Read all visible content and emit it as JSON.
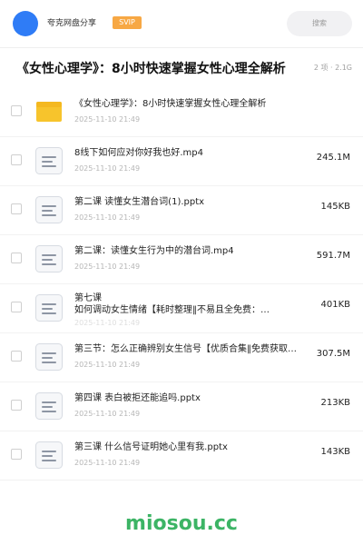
{
  "header": {
    "site_name": "夸克网盘分享",
    "badge": "SVIP",
    "search_placeholder": "搜索"
  },
  "folder": {
    "title": "《女性心理学》：8小时快速掌握女性心理全解析",
    "meta": "2 项 · 2.1G"
  },
  "colors": {
    "avatar": "#2f7cf6",
    "svip": "#f7a844",
    "folder_icon": "#f7c42c",
    "brand": "#3cb465"
  },
  "files": [
    {
      "icon": "folder-icon",
      "name": "《女性心理学》：8小时快速掌握女性心理全解析",
      "date": "2025-11-10 21:49",
      "size": ""
    },
    {
      "icon": "file-document-icon",
      "name": "8线下如何应对你好我也好.mp4",
      "date": "2025-11-10 21:49",
      "size": "245.1M"
    },
    {
      "icon": "file-document-icon",
      "name": "第二课 读懂女生潜台词(1).pptx",
      "date": "2025-11-10 21:49",
      "size": "145KB"
    },
    {
      "icon": "file-document-icon",
      "name": "第二课：读懂女生行为中的潜台词.mp4",
      "date": "2025-11-10 21:49",
      "size": "591.7M"
    },
    {
      "icon": "file-document-icon",
      "name": "第七课\n如何调动女生情绪【耗时整理‖不易且全免费：…",
      "date": "2025-11-10 21:49",
      "size": "401KB"
    },
    {
      "icon": "file-document-icon",
      "name": "第三节：怎么正确辨别女生信号【优质合集‖免费获取…",
      "date": "2025-11-10 21:49",
      "size": "307.5M"
    },
    {
      "icon": "file-document-icon",
      "name": "第四课 表白被拒还能追吗.pptx",
      "date": "2025-11-10 21:49",
      "size": "213KB"
    },
    {
      "icon": "file-document-icon",
      "name": "第三课 什么信号证明她心里有我.pptx",
      "date": "2025-11-10 21:49",
      "size": "143KB"
    }
  ],
  "footer": {
    "brand": "miosou.cc"
  }
}
